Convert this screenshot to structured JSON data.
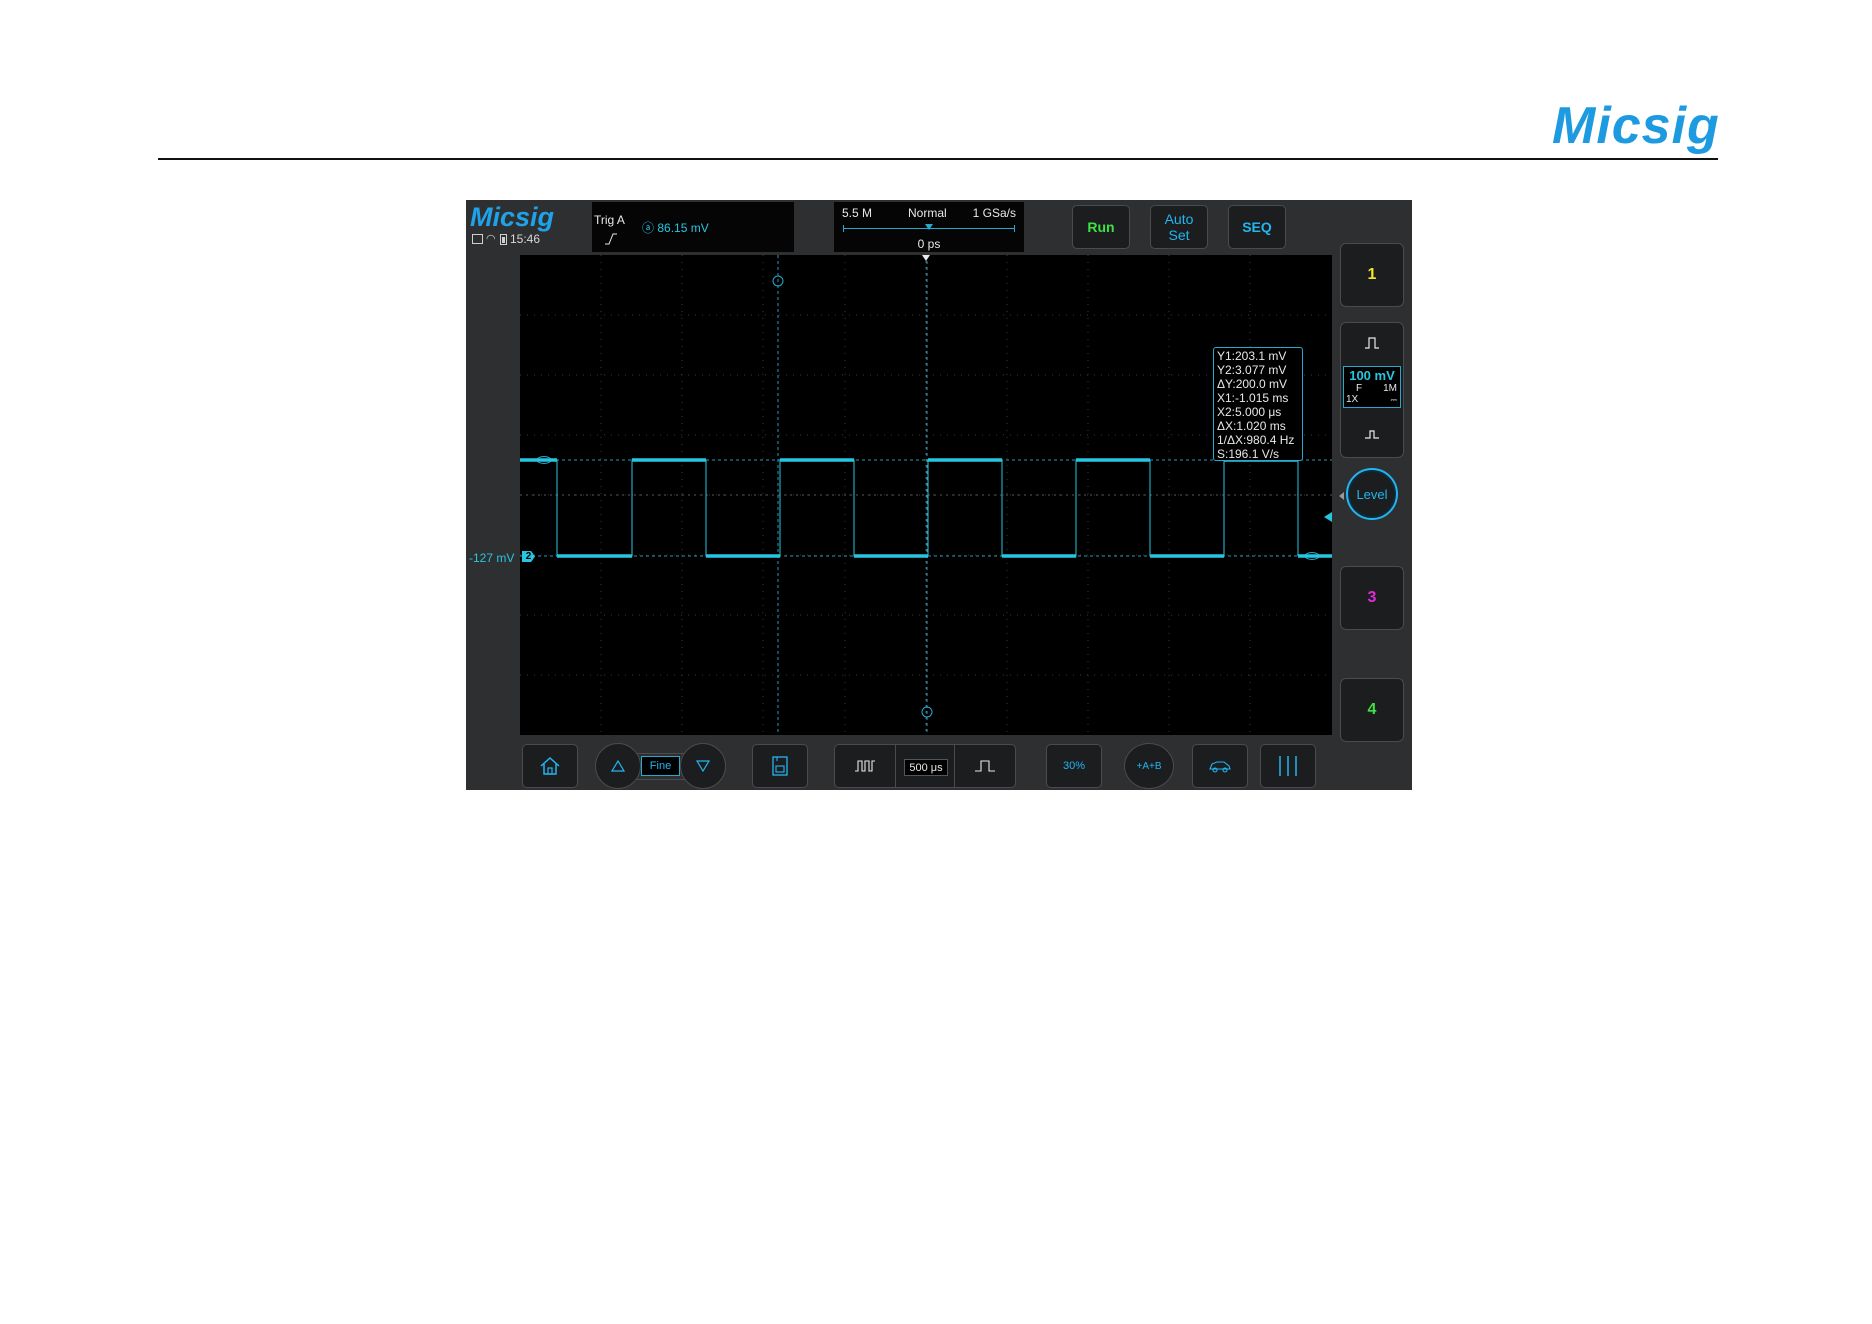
{
  "page": {
    "brand": "Micsig"
  },
  "scope": {
    "brand": "Micsig",
    "status": {
      "time": "15:46",
      "icons": [
        "screen-icon",
        "wifi-icon",
        "battery-icon"
      ]
    },
    "trigger": {
      "title": "Trig  A",
      "level": "86.15 mV",
      "slope": "rising-edge-icon"
    },
    "timebase": {
      "memory": "5.5 M",
      "mode": "Normal",
      "sample_rate": "1 GSa/s",
      "delay": "0 ps"
    },
    "buttons": {
      "run": "Run",
      "auto_line1": "Auto",
      "auto_line2": "Set",
      "seq": "SEQ"
    },
    "channel_offset_label": "-127 mV",
    "channel_marker": "2",
    "cursor_readout": [
      "Y1:203.1 mV",
      "Y2:3.077 mV",
      "ΔY:200.0 mV",
      "X1:-1.015 ms",
      "X2:5.000 μs",
      "ΔX:1.020 ms",
      "1/ΔX:980.4 Hz",
      "S:196.1 V/s"
    ],
    "channels": {
      "ch1": "1",
      "ch2": {
        "volts_div": "100 mV",
        "coupling": "F",
        "impedance": "1M",
        "probe": "1X",
        "dc_symbol": "⎓"
      },
      "ch3": "3",
      "ch4": "4"
    },
    "level_label": "Level",
    "bottom": {
      "fine_label": "Fine",
      "timebase_value": "500 μs",
      "percent_label": "30%",
      "ab_label": "+A+B"
    },
    "colors": {
      "trace": "#27c6e0",
      "accent": "#22b5f0",
      "ch1": "#f4e52a",
      "ch3": "#e22ad6",
      "ch4": "#3ee043"
    }
  }
}
